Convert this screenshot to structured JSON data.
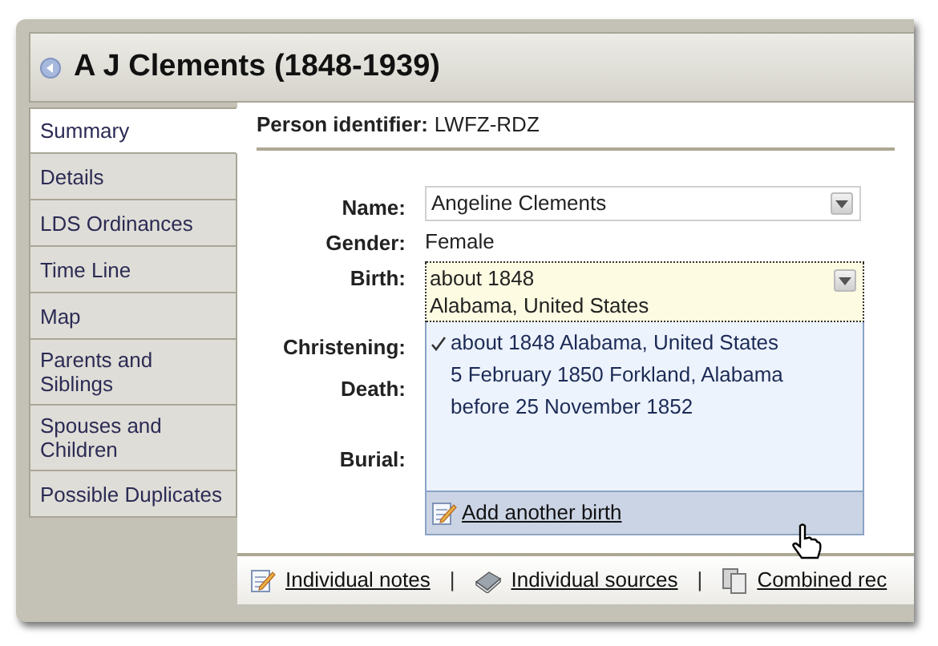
{
  "title": "A J Clements (1848-1939)",
  "tabs": [
    {
      "label": "Summary",
      "selected": true
    },
    {
      "label": "Details",
      "selected": false
    },
    {
      "label": "LDS Ordinances",
      "selected": false
    },
    {
      "label": "Time Line",
      "selected": false
    },
    {
      "label": "Map",
      "selected": false
    },
    {
      "label": "Parents and Siblings",
      "selected": false
    },
    {
      "label": "Spouses and Children",
      "selected": false
    },
    {
      "label": "Possible Duplicates",
      "selected": false
    }
  ],
  "person_identifier": {
    "label": "Person identifier:",
    "value": "LWFZ-RDZ"
  },
  "fields": [
    {
      "label": "Name:",
      "kind": "select",
      "value": "Angeline Clements"
    },
    {
      "label": "Gender:",
      "kind": "text",
      "value": "Female"
    },
    {
      "label": "Birth:",
      "kind": "open_select",
      "value": "about 1848",
      "value_line_2": "Alabama, United States"
    },
    {
      "label": "Christening:",
      "kind": "covered"
    },
    {
      "label": "Death:",
      "kind": "covered"
    },
    {
      "label": "Burial:",
      "kind": "covered"
    }
  ],
  "birth_dropdown": {
    "options": [
      {
        "text": "about 1848 Alabama, United States",
        "selected": true
      },
      {
        "text": "5 February 1850 Forkland, Alabama",
        "selected": false
      },
      {
        "text": "before 25 November 1852",
        "selected": false
      }
    ],
    "action": "Add another birth"
  },
  "footer_links": [
    {
      "kind": "link",
      "text": "Individual notes"
    },
    {
      "kind": "separator",
      "text": "|"
    },
    {
      "kind": "link",
      "text": "Individual sources"
    },
    {
      "kind": "separator",
      "text": "|"
    },
    {
      "kind": "link",
      "text": "Combined rec"
    }
  ]
}
